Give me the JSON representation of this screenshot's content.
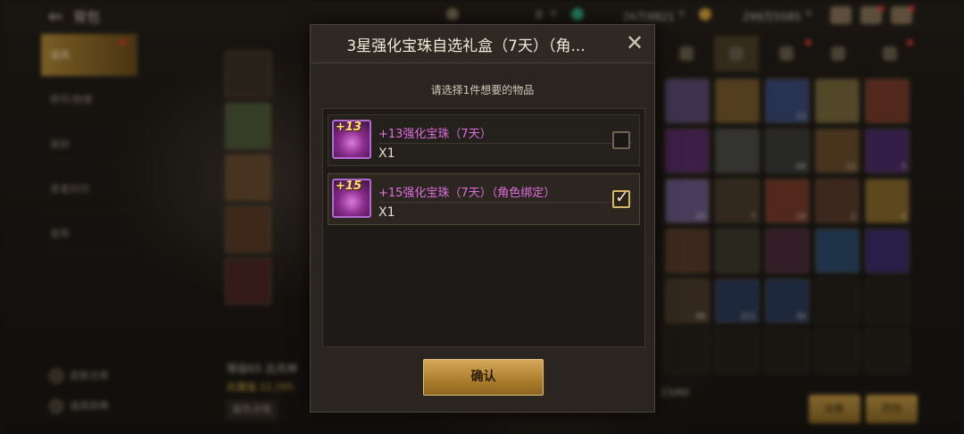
{
  "topbar": {
    "title": "背包",
    "currencies": [
      {
        "value": "0",
        "color": "#8a7a5a"
      },
      {
        "value": "26万8821",
        "color": "#2fb38a"
      },
      {
        "value": "299万5585",
        "color": "#d9a63a"
      }
    ]
  },
  "sidebar": {
    "items": [
      {
        "label": "道具"
      },
      {
        "label": "称号/勋章"
      },
      {
        "label": "装扮"
      },
      {
        "label": "圣者封印"
      },
      {
        "label": "金库"
      }
    ],
    "bottom_buttons": [
      {
        "label": "皮肤仓库"
      },
      {
        "label": "道具辞典"
      }
    ]
  },
  "left_slots": [
    {
      "badge": "60级"
    },
    {
      "badge": ""
    },
    {
      "badge": ""
    },
    {
      "badge": "60级"
    },
    {
      "badge": "60级"
    }
  ],
  "character": {
    "level_name": "等级65 古月神",
    "power_label": "抗魔值 22,295",
    "stats_button": "属性详情"
  },
  "inventory": {
    "capacity": "23/60",
    "slot_quantities": [
      "",
      "",
      "11",
      "",
      "",
      "",
      "",
      "49",
      "12",
      "3",
      "20",
      "7",
      "10",
      "2",
      "4",
      "",
      "",
      "",
      "",
      "",
      "96",
      "211",
      "30"
    ],
    "sell_button": "出售",
    "decompose_button": "药剂"
  },
  "dialog": {
    "title": "3星强化宝珠自选礼盒（7天）（角...",
    "subtitle": "请选择1件想要的物品",
    "options": [
      {
        "level_badge": "+13",
        "name": "+13强化宝珠（7天）",
        "quantity": "X1",
        "checked": false
      },
      {
        "level_badge": "+15",
        "name": "+15强化宝珠（7天）（角色绑定）",
        "quantity": "X1",
        "checked": true
      }
    ],
    "confirm_label": "确认",
    "name_color": "#e06de0"
  }
}
